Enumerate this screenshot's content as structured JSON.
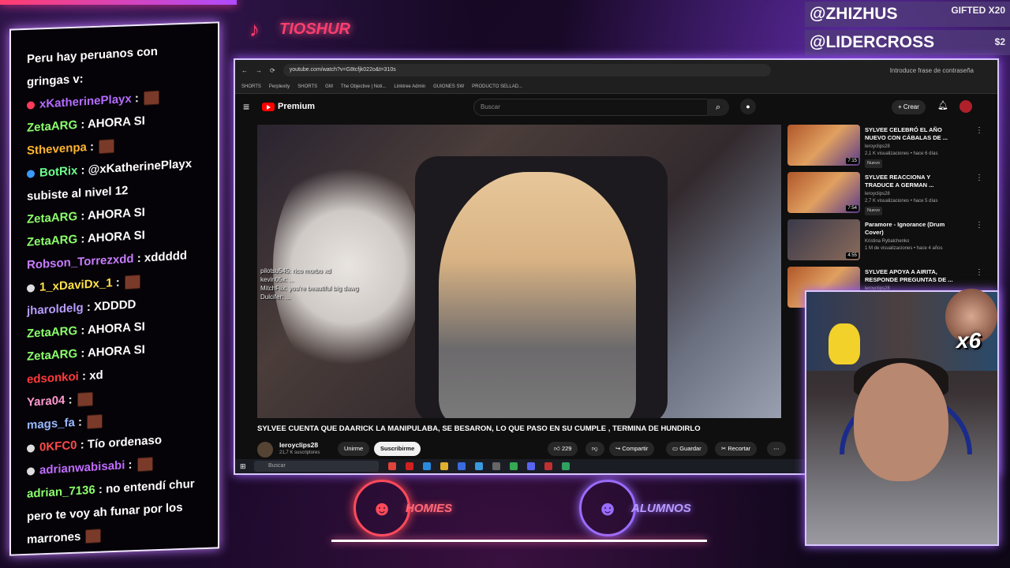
{
  "tiktok": {
    "name": "TIOSHUR"
  },
  "subs": [
    {
      "name": "@ZHIZHUS",
      "right": "GIFTED X20"
    },
    {
      "name": "@LIDERCROSS",
      "right": "$2"
    }
  ],
  "chat": [
    {
      "user": "",
      "text": "Peru hay peruanos con",
      "color": "#ffffff"
    },
    {
      "user": "",
      "text": "gringas v:",
      "color": "#ffffff"
    },
    {
      "user": "xKatherinePlayx",
      "text": ":",
      "color": "#b46cff",
      "icon": "ban-icon"
    },
    {
      "user": "ZetaARG",
      "text": ": AHORA SI",
      "color": "#8cff6c"
    },
    {
      "user": "Sthevenpa",
      "text": ":",
      "color": "#ffb430"
    },
    {
      "user": "BotRix",
      "text": ": @xKatherinePlayx",
      "color": "#6cff8c",
      "icon": "bot-icon"
    },
    {
      "user": "",
      "text": "subiste al nivel 12",
      "color": "#ffffff"
    },
    {
      "user": "ZetaARG",
      "text": ": AHORA SI",
      "color": "#8cff6c"
    },
    {
      "user": "ZetaARG",
      "text": ": AHORA SI",
      "color": "#8cff6c"
    },
    {
      "user": "Robson_Torrezxdd",
      "text": ": xddddd",
      "color": "#c87cff"
    },
    {
      "user": "1_xDaviDx_1",
      "text": ":",
      "color": "#ffe04a",
      "icon": "dot"
    },
    {
      "user": "jharoldelg",
      "text": ": XDDDD",
      "color": "#b89cff"
    },
    {
      "user": "ZetaARG",
      "text": ": AHORA SI",
      "color": "#8cff6c"
    },
    {
      "user": "ZetaARG",
      "text": ": AHORA SI",
      "color": "#8cff6c"
    },
    {
      "user": "edsonkoi",
      "text": ": xd",
      "color": "#ff3a3a"
    },
    {
      "user": "Yara04",
      "text": ":",
      "color": "#ff9ad0"
    },
    {
      "user": "mags_fa",
      "text": ":",
      "color": "#9ab8ff"
    },
    {
      "user": "0KFC0",
      "text": ": Tío ordenaso",
      "color": "#ff4a4a",
      "icon": "dot"
    },
    {
      "user": "adrianwabisabi",
      "text": ":",
      "color": "#c06cff",
      "icon": "dot"
    },
    {
      "user": "adrian_7136",
      "text": ": no entendí chur",
      "color": "#8cff6c"
    },
    {
      "user": "",
      "text": "pero te voy ah funar por los",
      "color": "#ffffff"
    },
    {
      "user": "",
      "text": "marrones",
      "color": "#ffffff"
    }
  ],
  "browser": {
    "url": "youtube.com/watch?v=G8tcfjk022o&t=310s",
    "bookmarks": [
      "SHORTS",
      "Perplexity",
      "SHORTS",
      "GM",
      "The Objective | Noti...",
      "Linktree Admin",
      "GUIONES SW",
      "PRODUCTO SELLAD..."
    ],
    "password_hint": "Introduce frase de contraseña"
  },
  "youtube": {
    "logo": "Premium",
    "search_placeholder": "Buscar",
    "create_label": "Crear",
    "video_title": "SYLVEE CUENTA QUE DAARICK LA MANIPULABA, SE BESARON, LO QUE PASO EN SU CUMPLE , TERMINA DE HUNDIRLO",
    "channel": "leroyclips28",
    "subscribers": "21,7 K suscriptores",
    "join_label": "Unirme",
    "subscribe_label": "Suscribirme",
    "likes": "229",
    "share_label": "Compartir",
    "save_label": "Guardar",
    "clip_label": "Recortar",
    "overlay_chat": [
      "pilotsu545: rico morbo xd",
      "kevin05x: ...",
      "MitchFlix: you're beautiful big dawg",
      "Dulcifer: ..."
    ],
    "recommendations": [
      {
        "title": "SYLVEE CELEBRÓ EL AÑO NUEVO CON CÁBALAS DE ...",
        "channel": "leroyclips28",
        "meta": "2,1 K visualizaciones • hace 6 días",
        "badge": "Nuevo",
        "duration": "7:15"
      },
      {
        "title": "SYLVEE REACCIONA Y TRADUCE A GERMAN ...",
        "channel": "leroyclips28",
        "meta": "2,7 K visualizaciones • hace 5 días",
        "badge": "Nuevo",
        "duration": "7:54"
      },
      {
        "title": "Paramore - Ignorance (Drum Cover)",
        "channel": "Kristina Rybalchenko",
        "meta": "1 M de visualizaciones • hace 4 años",
        "badge": "",
        "duration": "4:55"
      },
      {
        "title": "SYLVEE APOYA A AIRITA, RESPONDE PREGUNTAS DE ...",
        "channel": "leroyclips28",
        "meta": "",
        "badge": "",
        "duration": ""
      }
    ]
  },
  "taskbar": {
    "search_placeholder": "Buscar"
  },
  "webcam": {
    "multiplier": "x6"
  },
  "teams": [
    {
      "name": "HOMIES",
      "color": "#ff4a5a"
    },
    {
      "name": "ALUMNOS",
      "color": "#9a6cff"
    }
  ]
}
